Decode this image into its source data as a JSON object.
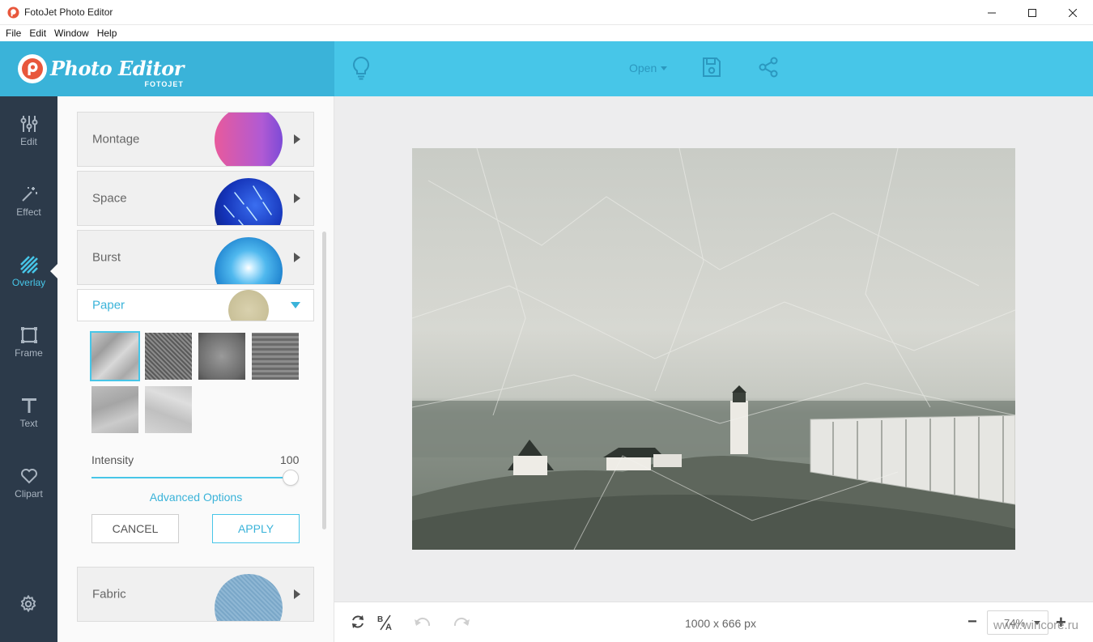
{
  "window": {
    "title": "FotoJet Photo Editor",
    "controls": [
      "minimize",
      "maximize",
      "close"
    ]
  },
  "menu": [
    "File",
    "Edit",
    "Window",
    "Help"
  ],
  "header": {
    "logo_main": "Photo Editor",
    "logo_sub": "FOTOJET",
    "open_label": "Open",
    "icons": [
      "lightbulb-icon",
      "save-icon",
      "share-icon"
    ]
  },
  "rail": [
    {
      "label": "Edit",
      "icon": "sliders-icon"
    },
    {
      "label": "Effect",
      "icon": "magic-wand-icon"
    },
    {
      "label": "Overlay",
      "icon": "overlay-stripes-icon",
      "active": true
    },
    {
      "label": "Frame",
      "icon": "frame-icon"
    },
    {
      "label": "Text",
      "icon": "text-icon"
    },
    {
      "label": "Clipart",
      "icon": "heart-icon"
    }
  ],
  "panel": {
    "categories": [
      {
        "label": "Montage"
      },
      {
        "label": "Space"
      },
      {
        "label": "Burst"
      },
      {
        "label": "Paper",
        "expanded": true
      },
      {
        "label": "Fabric"
      }
    ],
    "paper_textures_count": 6,
    "selected_texture": 1,
    "intensity_label": "Intensity",
    "intensity_value": "100",
    "intensity_level": 1.0,
    "advanced_label": "Advanced Options",
    "cancel_label": "CANCEL",
    "apply_label": "APPLY"
  },
  "status": {
    "dimensions": "1000 x 666 px",
    "zoom": "74%",
    "watermark": "www.wincore.ru"
  },
  "colors": {
    "accent": "#47c6e8",
    "header": "#47c6e8",
    "rail": "#2c3a4a"
  }
}
